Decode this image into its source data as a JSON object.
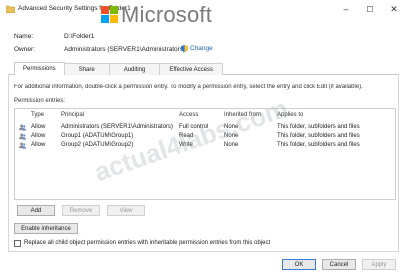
{
  "window": {
    "title": "Advanced Security Settings for Folder1",
    "minimize": "–",
    "maximize": "☐",
    "close": "✕"
  },
  "watermarks": {
    "logo_text": "Microsoft",
    "site_text": "actual4labs.com"
  },
  "header": {
    "name_label": "Name:",
    "name_value": "D:\\Folder1",
    "owner_label": "Owner:",
    "owner_value": "Administrators (SERVER1\\Administrators)",
    "change_link": "Change"
  },
  "tabs": [
    {
      "label": "Permissions",
      "active": true
    },
    {
      "label": "Share",
      "active": false
    },
    {
      "label": "Auditing",
      "active": false
    },
    {
      "label": "Effective Access",
      "active": false
    }
  ],
  "permissions": {
    "info_text": "For additional information, double-click a permission entry. To modify a permission entry, select the entry and click Edit (if available).",
    "entries_label": "Permission entries:",
    "columns": [
      "Type",
      "Principal",
      "Access",
      "Inherited from",
      "Applies to"
    ],
    "rows": [
      {
        "type": "Allow",
        "principal": "Administrators (SERVER1\\Administrators)",
        "access": "Full control",
        "inherited": "None",
        "applies": "This folder, subfolders and files"
      },
      {
        "type": "Allow",
        "principal": "Group1 (ADATUM\\Group1)",
        "access": "Read",
        "inherited": "None",
        "applies": "This folder, subfolders and files"
      },
      {
        "type": "Allow",
        "principal": "Group2 (ADATUM\\Group2)",
        "access": "Write",
        "inherited": "None",
        "applies": "This folder, subfolders and files"
      }
    ],
    "add_button": "Add",
    "remove_button": "Remove",
    "view_button": "View",
    "enable_inheritance_button": "Enable inheritance",
    "replace_checkbox_label": "Replace all child object permission entries with inheritable permission entries from this object",
    "replace_checked": false
  },
  "footer": {
    "ok": "OK",
    "cancel": "Cancel",
    "apply": "Apply"
  },
  "colors": {
    "link": "#1a5fb4",
    "ms_red": "#f25022",
    "ms_green": "#7fba00",
    "ms_blue": "#00a4ef",
    "ms_yellow": "#ffb900"
  }
}
